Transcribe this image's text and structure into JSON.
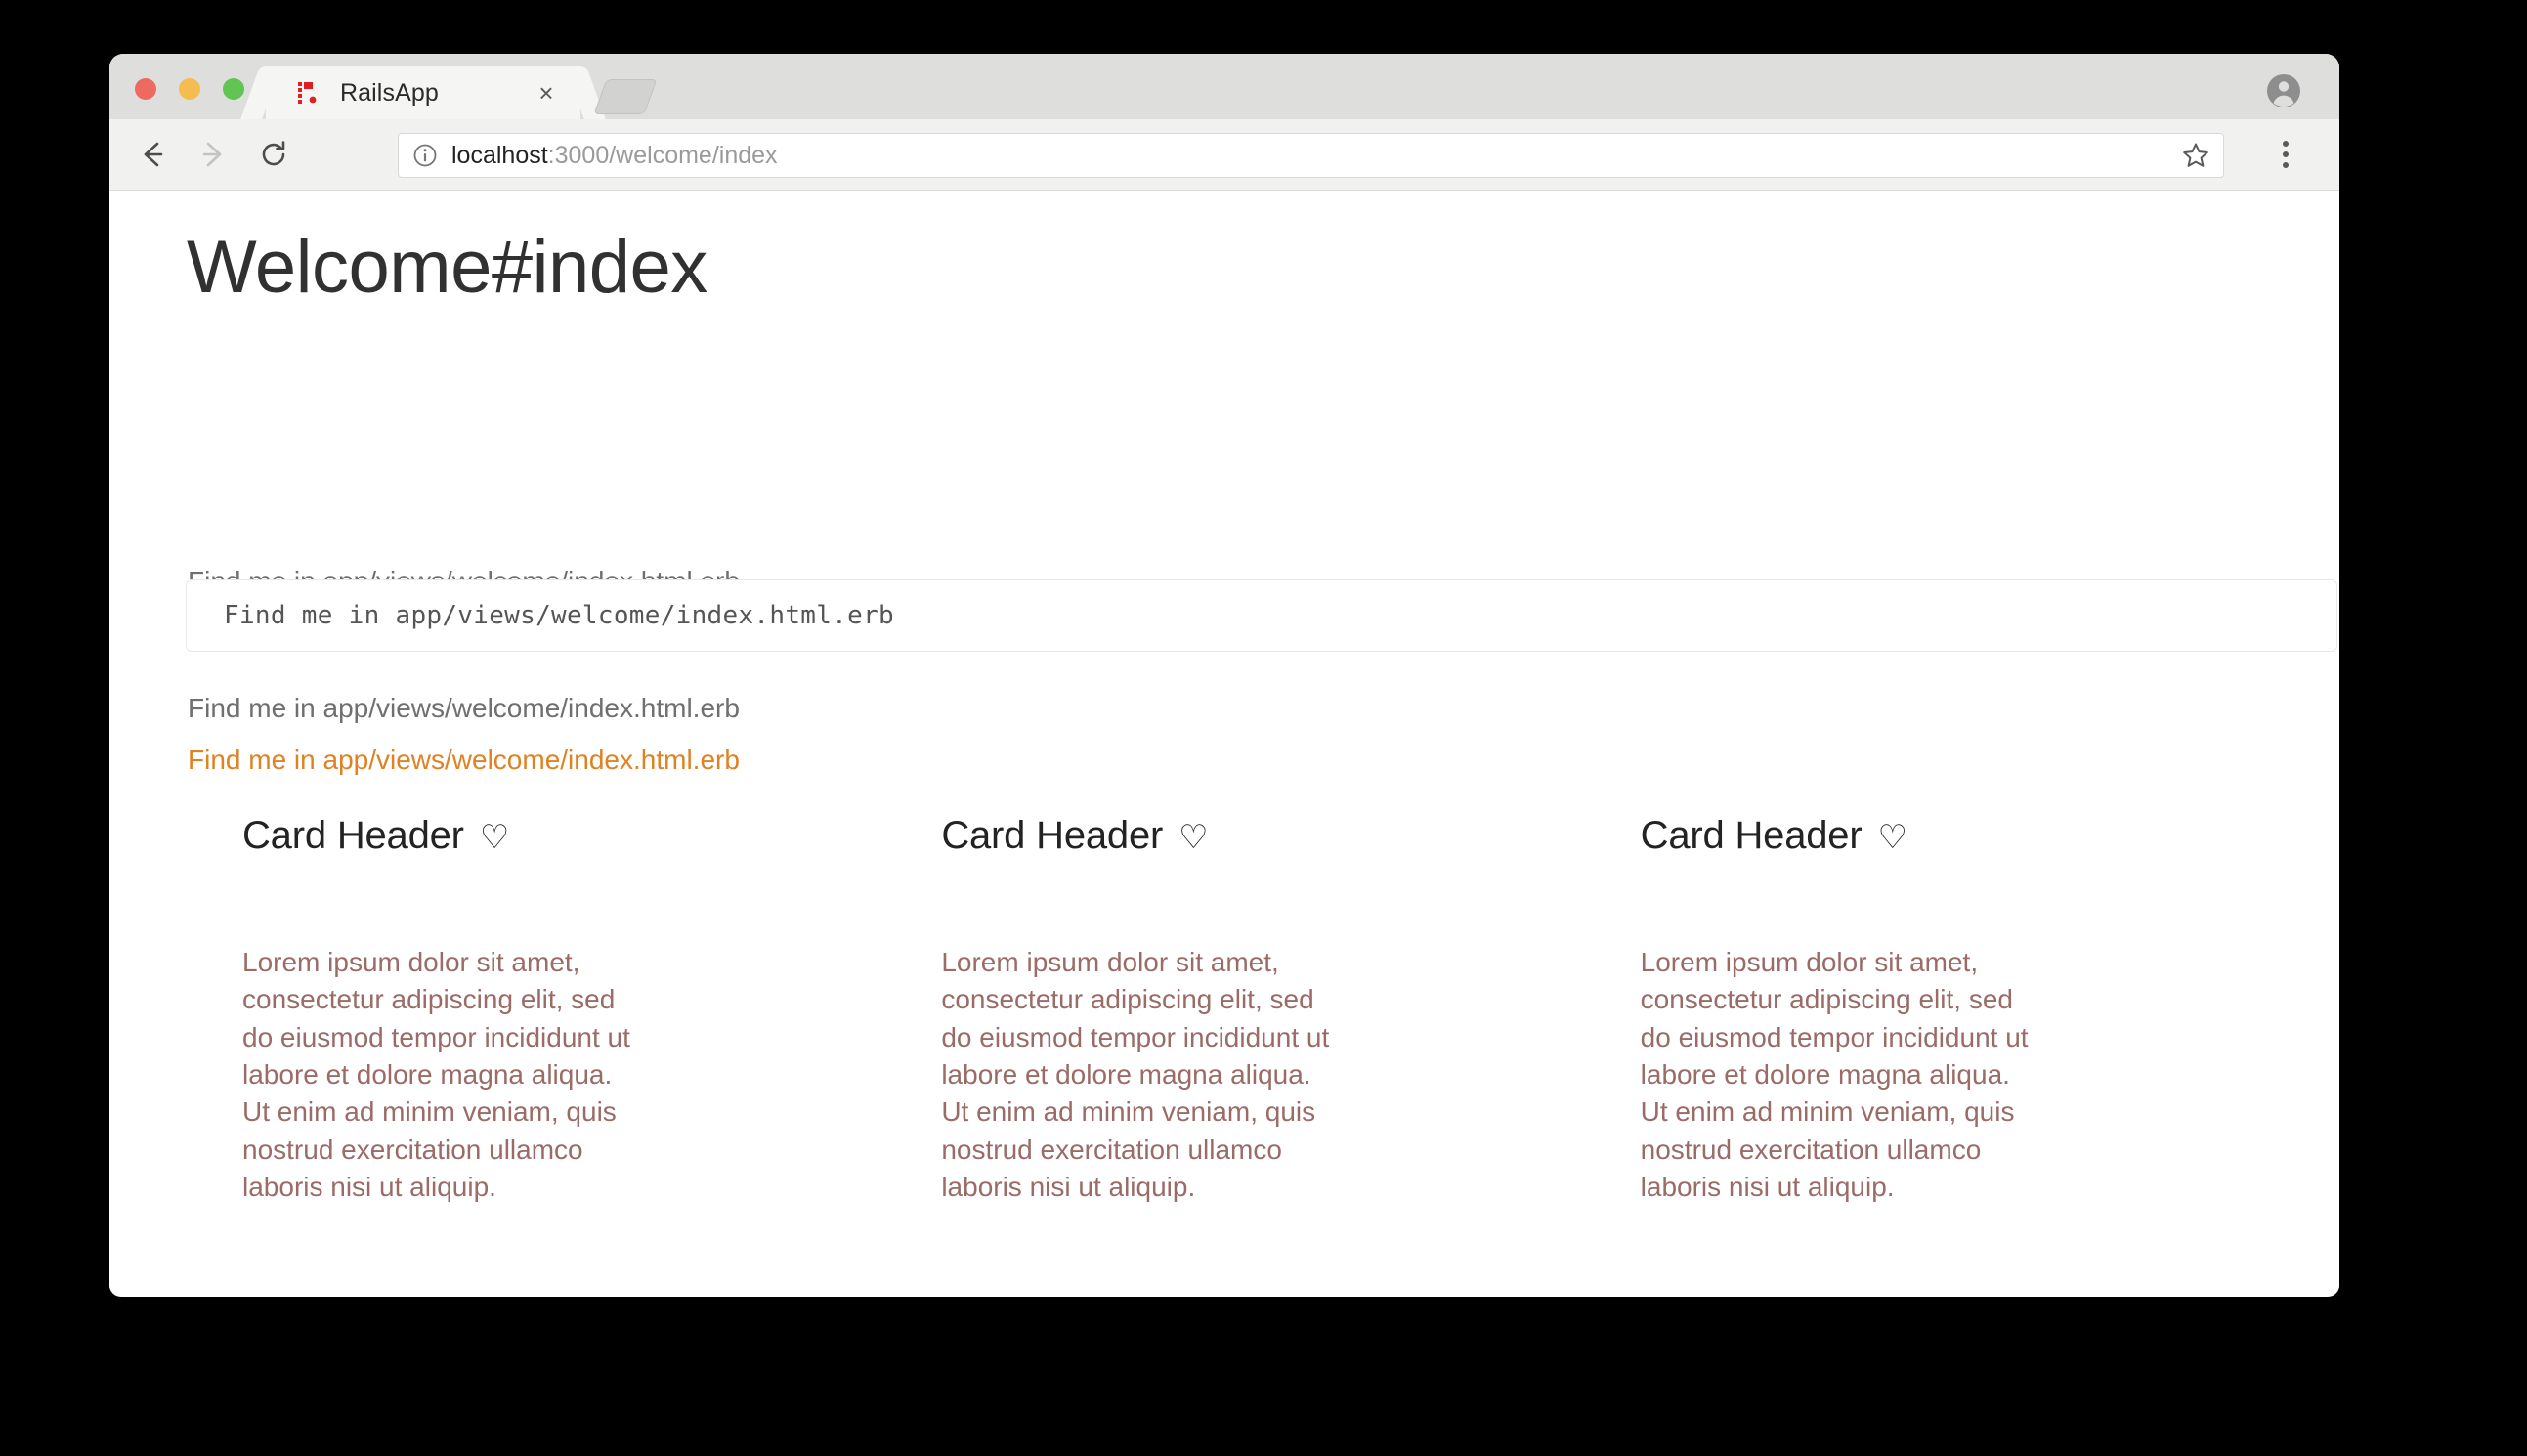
{
  "window": {
    "tab": {
      "title": "RailsApp",
      "favicon_name": "rails-favicon",
      "close_label": "×"
    },
    "new_tab_label": "",
    "profile_label": ""
  },
  "toolbar": {
    "back_label": "",
    "forward_label": "",
    "reload_label": "",
    "url_host": "localhost",
    "url_rest": ":3000/welcome/index",
    "bookmark_label": "",
    "menu_label": ""
  },
  "page": {
    "title": "Welcome#index",
    "paragraph_1": "Find me in app/views/welcome/index.html.erb",
    "code_text": "Find me in app/views/welcome/index.html.erb",
    "paragraph_3": "Find me in app/views/welcome/index.html.erb",
    "paragraph_4": "Find me in app/views/welcome/index.html.erb",
    "cards": [
      {
        "header": "Card Header",
        "heart": "♡",
        "body": "Lorem ipsum dolor sit amet, consectetur adipiscing elit, sed do eiusmod tempor incididunt ut labore et dolore magna aliqua. Ut enim ad minim veniam, quis nostrud exercitation ullamco laboris nisi ut aliquip."
      },
      {
        "header": "Card Header",
        "heart": "♡",
        "body": "Lorem ipsum dolor sit amet, consectetur adipiscing elit, sed do eiusmod tempor incididunt ut labore et dolore magna aliqua. Ut enim ad minim veniam, quis nostrud exercitation ullamco laboris nisi ut aliquip."
      },
      {
        "header": "Card Header",
        "heart": "♡",
        "body": "Lorem ipsum dolor sit amet, consectetur adipiscing elit, sed do eiusmod tempor incididunt ut labore et dolore magna aliqua. Ut enim ad minim veniam, quis nostrud exercitation ullamco laboris nisi ut aliquip."
      }
    ]
  },
  "colors": {
    "accent_orange": "#e08123",
    "card_body_rose": "#9a6b67",
    "rails_red": "#e02020",
    "traffic_red": "#ec6a5f",
    "traffic_yellow": "#f4bd4f",
    "traffic_green": "#61c554"
  }
}
